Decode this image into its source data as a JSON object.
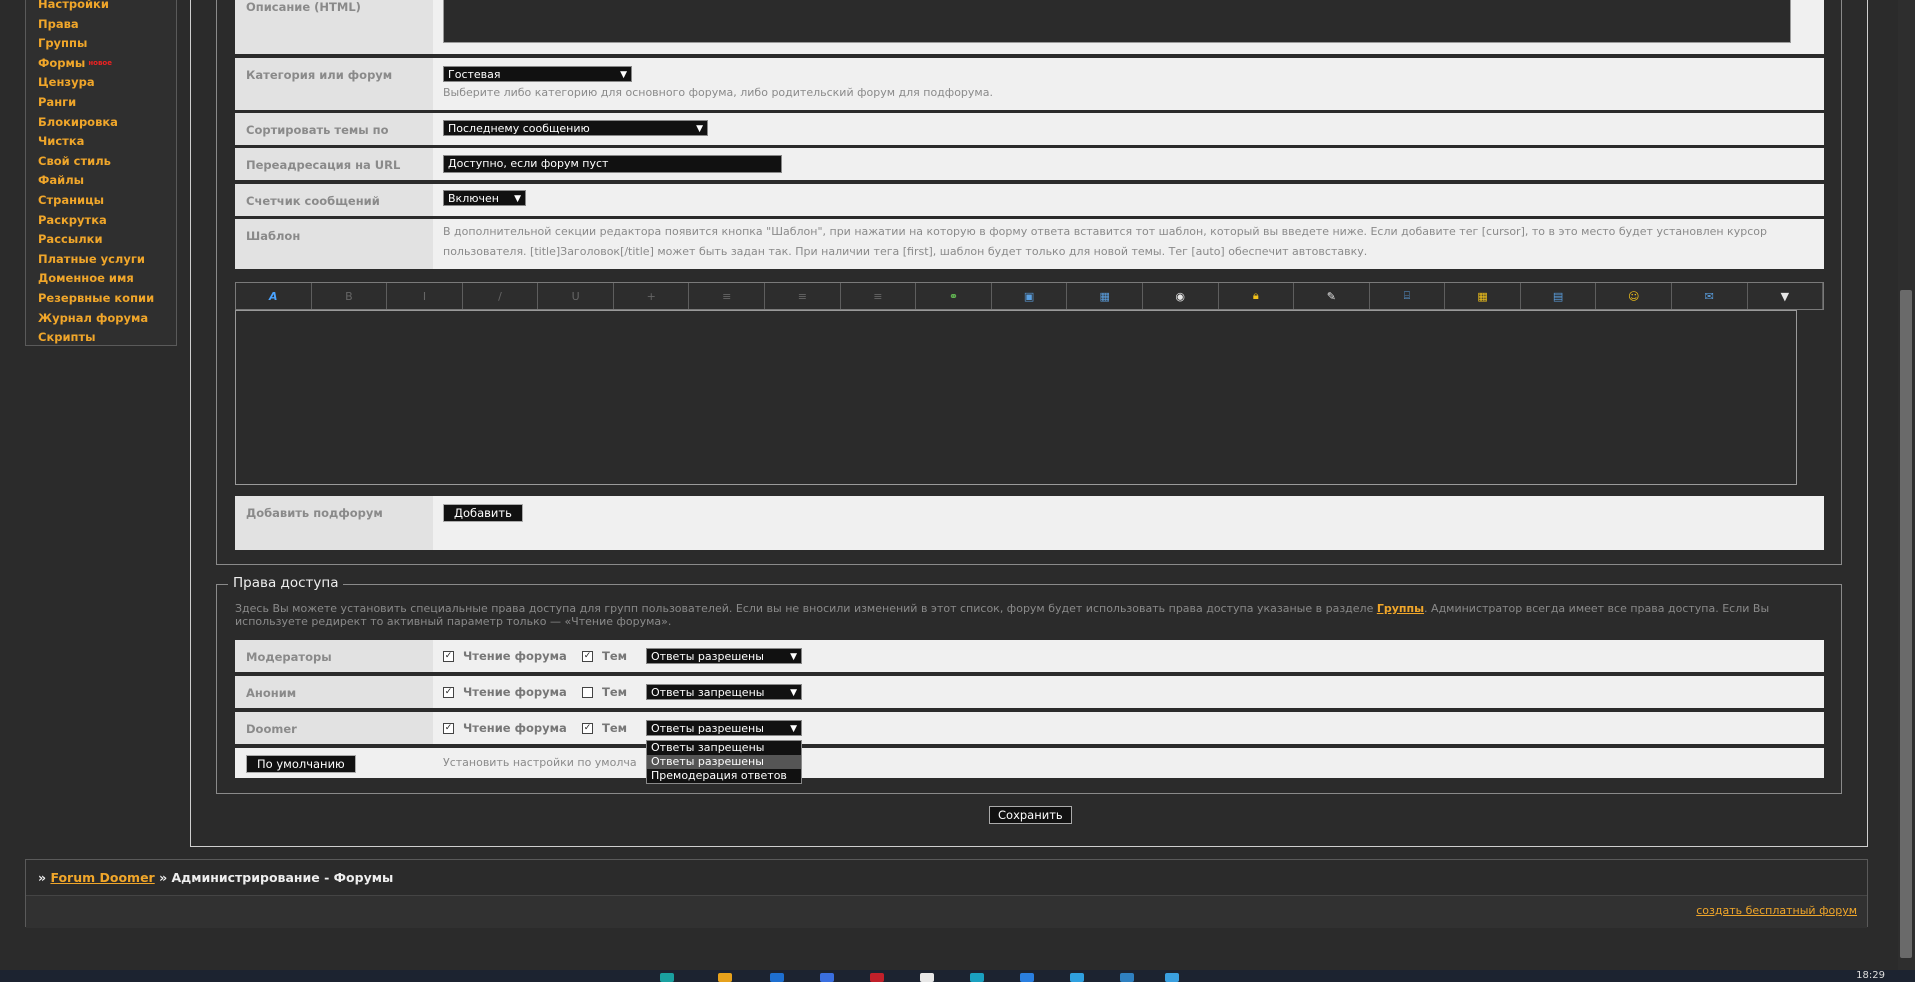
{
  "sidebar": {
    "items": [
      {
        "label": "Настройки"
      },
      {
        "label": "Права"
      },
      {
        "label": "Группы"
      },
      {
        "label": "Формы",
        "badge": "новое"
      },
      {
        "label": "Цензура"
      },
      {
        "label": "Ранги"
      },
      {
        "label": "Блокировка"
      },
      {
        "label": "Чистка"
      },
      {
        "label": "Свой стиль"
      },
      {
        "label": "Файлы"
      },
      {
        "label": "Страницы"
      },
      {
        "label": "Раскрутка"
      },
      {
        "label": "Рассылки"
      },
      {
        "label": "Платные услуги"
      },
      {
        "label": "Доменное имя"
      },
      {
        "label": "Резервные копии"
      },
      {
        "label": "Журнал форума"
      },
      {
        "label": "Скрипты"
      }
    ]
  },
  "form": {
    "description_label": "Описание (HTML)",
    "category_label": "Категория или форум",
    "category_value": "Гостевая",
    "category_hint": "Выберите либо категорию для основного форума, либо родительский форум для подфорума.",
    "sort_label": "Сортировать темы по",
    "sort_value": "Последнему сообщению",
    "redirect_label": "Переадресация на URL",
    "redirect_value": "Доступно, если форум пуст",
    "counter_label": "Счетчик сообщений",
    "counter_value": "Включен",
    "template_label": "Шаблон",
    "template_hint": "В дополнительной секции редактора появится кнопка \"Шаблон\", при нажатии на которую в форму ответа вставится тот шаблон, который вы введете ниже. Если добавите тег [cursor], то в это место будет установлен курсор пользователя. [title]Заголовок[/title] может быть задан так. При наличии тега [first], шаблон будет только для новой темы. Тег [auto] обеспечит автовставку.",
    "subforum_label": "Добавить подфорум",
    "subforum_button": "Добавить"
  },
  "toolbar": {
    "icons": [
      "font-icon",
      "bold-icon",
      "italic-icon",
      "underline-icon",
      "strike-icon",
      "align-left-icon",
      "align-center-icon",
      "align-right-icon",
      "link-icon",
      "image-icon",
      "media-icon",
      "video-icon",
      "lock-icon",
      "quote-icon",
      "code-icon",
      "table-icon",
      "list-icon",
      "smile-icon",
      "message-icon",
      "more-icon"
    ]
  },
  "access": {
    "legend": "Права доступа",
    "desc_before": "Здесь Вы можете установить специальные права доступа для групп пользователей. Если вы не вносили изменений в этот список, форум будет использовать права доступа указаные в разделе ",
    "desc_link": "Группы",
    "desc_after": ". Администратор всегда имеет все права доступа. Если Вы используете редирект то активный параметр только — «Чтение форума».",
    "read_label": "Чтение форума",
    "topics_label": "Тем",
    "rows": [
      {
        "group": "Модераторы",
        "read": true,
        "topics": true,
        "replies": "Ответы разрешены"
      },
      {
        "group": "Аноним",
        "read": true,
        "topics": false,
        "replies": "Ответы запрещены"
      },
      {
        "group": "Doomer",
        "read": true,
        "topics": true,
        "replies": "Ответы разрешены"
      }
    ],
    "default_button": "По умолчанию",
    "default_hint": "Установить настройки по умолча",
    "dropdown_options": [
      "Ответы запрещены",
      "Ответы разрешены",
      "Премодерация ответов"
    ],
    "dropdown_selected": "Ответы разрешены"
  },
  "save_button": "Сохранить",
  "breadcrumb": {
    "prefix": "» ",
    "forum_link": "Forum Doomer",
    "current": " » Администрирование - Форумы"
  },
  "footer": {
    "free_forum_link": "создать бесплатный форум"
  },
  "taskbar": {
    "clock": "18:29"
  },
  "colors": {
    "accent": "#f0a62a",
    "badge": "#ee2222",
    "background": "#2b2b2b",
    "row": "#f0f0f0"
  }
}
